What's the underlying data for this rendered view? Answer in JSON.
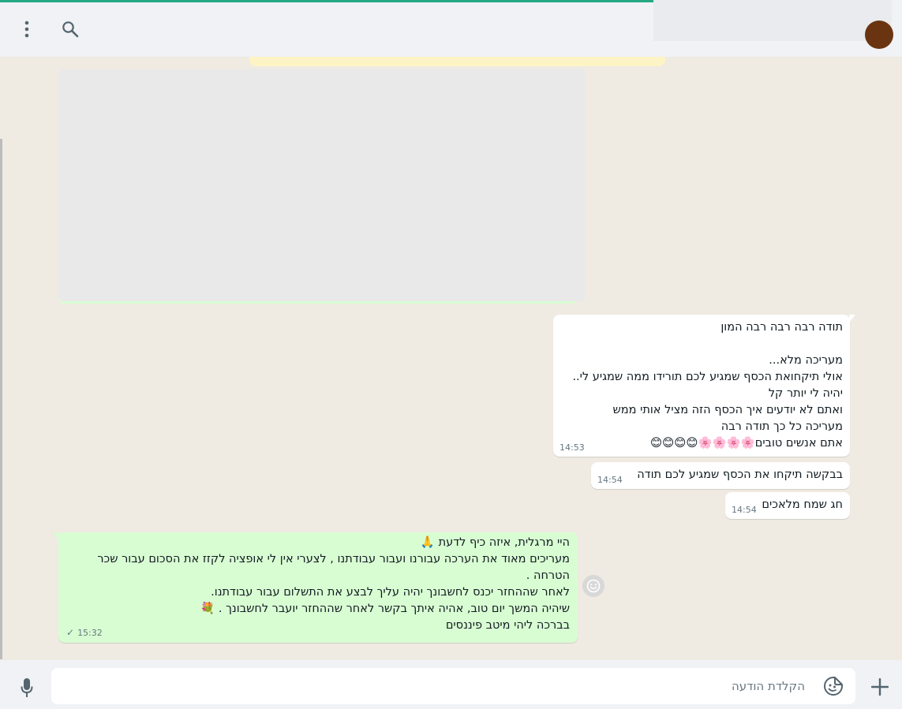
{
  "header": {
    "menu_icon": "vertical-dots-icon",
    "search_icon": "search-icon"
  },
  "messages": [
    {
      "direction": "in",
      "lines": [
        "תודה רבה רבה רבה המון",
        "",
        "מעריכה מלא...",
        "אולי תיקחואת הכסף שמגיע לכם תורידו ממה שמגיע לי..",
        "יהיה לי יותר קל",
        "ואתם לא יודעים איך הכסף הזה מציל אותי ממש",
        "מעריכה כל כך תודה רבה",
        "אתם אנשים טובים🌸🌸🌸🌸😊😊😊😊"
      ],
      "time": "14:53"
    },
    {
      "direction": "in",
      "lines": [
        "בבקשה תיקחו את הכסף שמגיע לכם תודה"
      ],
      "time": "14:54"
    },
    {
      "direction": "in",
      "lines": [
        "חג שמח מלאכים"
      ],
      "time": "14:54"
    },
    {
      "direction": "out",
      "lines": [
        "היי מרגלית, איזה כיף לדעת 🙏",
        "מעריכים מאוד את הערכה עבורנו ועבור עבודתנו , לצערי אין לי אופציה לקזז את הסכום עבור שכר",
        "הטרחה .",
        "לאחר שההחזר יכנס לחשבונך יהיה עליך לבצע את התשלום עבור עבודתנו.",
        "שיהיה המשך יום טוב, אהיה איתך בקשר לאחר שההחזר יועבר לחשבונך . 💐",
        "בברכה ליהי מיטב פיננסים"
      ],
      "time": "15:32",
      "status": "sent-check-icon"
    }
  ],
  "composer": {
    "placeholder": "הקלדת הודעה",
    "sticker_icon": "sticker-icon",
    "attach_icon": "plus-icon",
    "mic_icon": "microphone-icon"
  },
  "colors": {
    "accent": "#25a883",
    "incoming_bubble": "#ffffff",
    "outgoing_bubble": "#d9fdd3",
    "chat_background": "#efeae2"
  }
}
